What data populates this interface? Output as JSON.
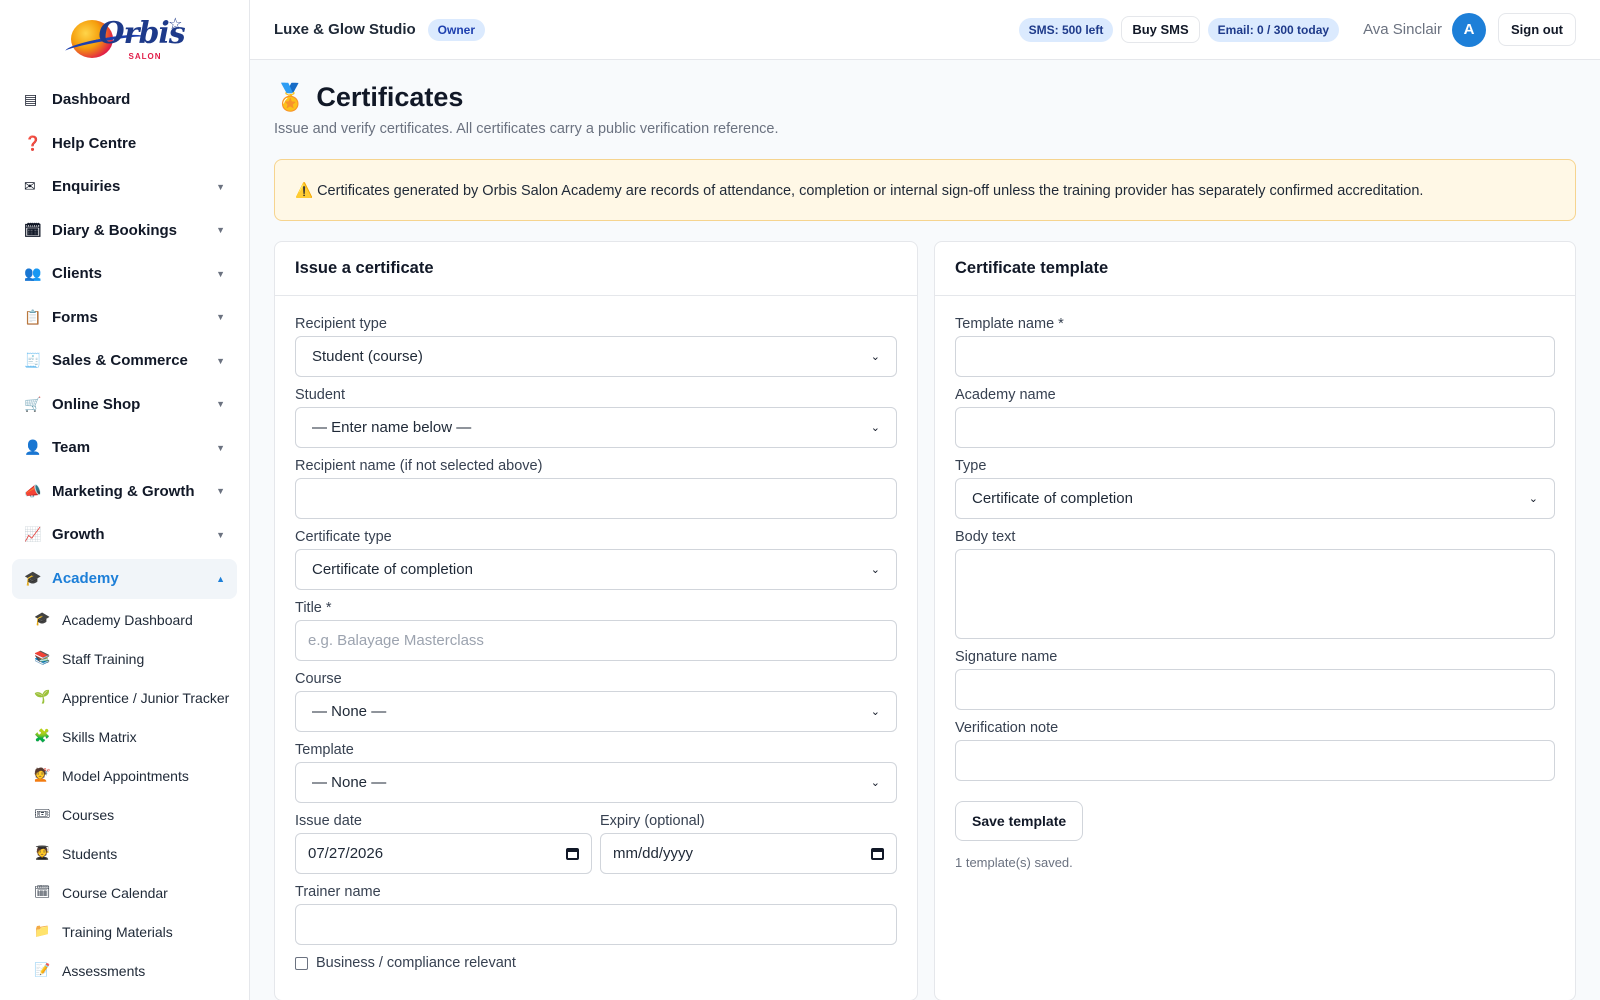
{
  "brand": {
    "logo_text": "Orbis",
    "logo_sub": "SALON"
  },
  "sidebar": {
    "items": [
      {
        "label": "Dashboard",
        "icon": "▤"
      },
      {
        "label": "Help Centre",
        "icon": "❓"
      },
      {
        "label": "Enquiries",
        "icon": "✉"
      },
      {
        "label": "Diary & Bookings",
        "icon": "🗓"
      },
      {
        "label": "Clients",
        "icon": "👥"
      },
      {
        "label": "Forms",
        "icon": "📋"
      },
      {
        "label": "Sales & Commerce",
        "icon": "🧾"
      },
      {
        "label": "Online Shop",
        "icon": "🛒"
      },
      {
        "label": "Team",
        "icon": "👤"
      },
      {
        "label": "Marketing & Growth",
        "icon": "📣"
      },
      {
        "label": "Growth",
        "icon": "📈"
      }
    ],
    "caret_down": "▼",
    "caret_up": "▲",
    "academy": {
      "label": "Academy",
      "icon": "🎓"
    },
    "academy_sub": [
      {
        "label": "Academy Dashboard",
        "icon": "🎓"
      },
      {
        "label": "Staff Training",
        "icon": "📚"
      },
      {
        "label": "Apprentice / Junior Tracker",
        "icon": "🌱"
      },
      {
        "label": "Skills Matrix",
        "icon": "🧩"
      },
      {
        "label": "Model Appointments",
        "icon": "💇"
      },
      {
        "label": "Courses",
        "icon": "🎟"
      },
      {
        "label": "Students",
        "icon": "🧑‍🎓"
      },
      {
        "label": "Course Calendar",
        "icon": "🗓"
      },
      {
        "label": "Training Materials",
        "icon": "📁"
      },
      {
        "label": "Assessments",
        "icon": "📝"
      }
    ]
  },
  "topbar": {
    "studio": "Luxe & Glow Studio",
    "role": "Owner",
    "sms": "SMS: 500 left",
    "buy_sms": "Buy SMS",
    "email": "Email: 0 / 300 today",
    "user": "Ava Sinclair",
    "avatar": "A",
    "sign_out": "Sign out"
  },
  "page": {
    "icon": "🏅",
    "title": "Certificates",
    "subtitle": "Issue and verify certificates. All certificates carry a public verification reference.",
    "notice": "⚠️ Certificates generated by Orbis Salon Academy are records of attendance, completion or internal sign-off unless the training provider has separately confirmed accreditation."
  },
  "issue": {
    "heading": "Issue a certificate",
    "recipient_type_label": "Recipient type",
    "recipient_type_value": "Student (course)",
    "student_label": "Student",
    "student_value": "— Enter name below —",
    "recipient_name_label": "Recipient name (if not selected above)",
    "recipient_name_value": "",
    "cert_type_label": "Certificate type",
    "cert_type_value": "Certificate of completion",
    "title_label": "Title *",
    "title_placeholder": "e.g. Balayage Masterclass",
    "course_label": "Course",
    "course_value": "— None —",
    "template_label": "Template",
    "template_value": "— None —",
    "issue_date_label": "Issue date",
    "issue_date_value": "07/27/2026",
    "expiry_label": "Expiry (optional)",
    "expiry_value": "mm/dd/yyyy",
    "trainer_label": "Trainer name",
    "trainer_value": "",
    "compliance_label": "Business / compliance relevant"
  },
  "template": {
    "heading": "Certificate template",
    "name_label": "Template name *",
    "name_value": "",
    "academy_label": "Academy name",
    "academy_value": "",
    "type_label": "Type",
    "type_value": "Certificate of completion",
    "body_label": "Body text",
    "signature_label": "Signature name",
    "signature_value": "",
    "verification_label": "Verification note",
    "verification_value": "",
    "save_label": "Save template",
    "saved_note": "1 template(s) saved."
  },
  "colors": {
    "accent": "#1d7fd8",
    "notice_bg": "#fff8e6",
    "notice_border": "#f6d48f"
  }
}
